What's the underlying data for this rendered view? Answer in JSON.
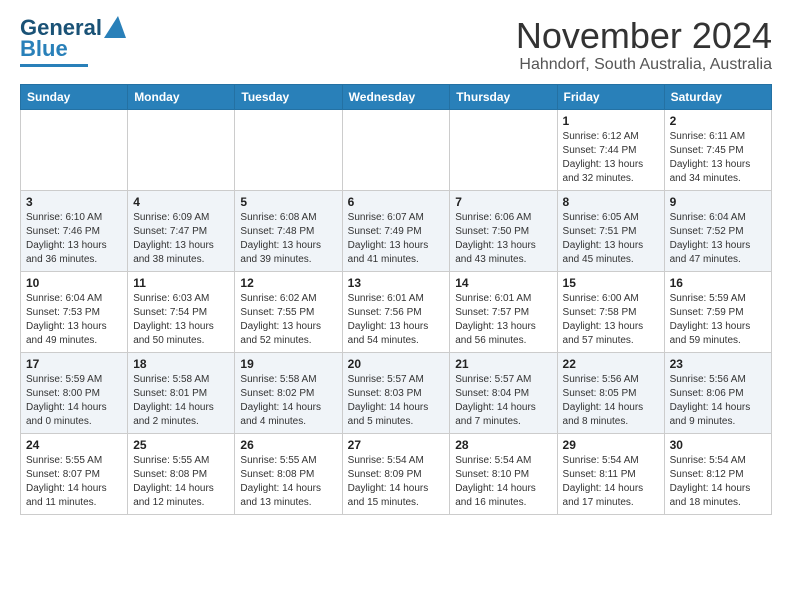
{
  "header": {
    "logo_line1": "General",
    "logo_line2": "Blue",
    "title": "November 2024",
    "subtitle": "Hahndorf, South Australia, Australia"
  },
  "weekdays": [
    "Sunday",
    "Monday",
    "Tuesday",
    "Wednesday",
    "Thursday",
    "Friday",
    "Saturday"
  ],
  "weeks": [
    [
      {
        "day": "",
        "info": ""
      },
      {
        "day": "",
        "info": ""
      },
      {
        "day": "",
        "info": ""
      },
      {
        "day": "",
        "info": ""
      },
      {
        "day": "",
        "info": ""
      },
      {
        "day": "1",
        "info": "Sunrise: 6:12 AM\nSunset: 7:44 PM\nDaylight: 13 hours\nand 32 minutes."
      },
      {
        "day": "2",
        "info": "Sunrise: 6:11 AM\nSunset: 7:45 PM\nDaylight: 13 hours\nand 34 minutes."
      }
    ],
    [
      {
        "day": "3",
        "info": "Sunrise: 6:10 AM\nSunset: 7:46 PM\nDaylight: 13 hours\nand 36 minutes."
      },
      {
        "day": "4",
        "info": "Sunrise: 6:09 AM\nSunset: 7:47 PM\nDaylight: 13 hours\nand 38 minutes."
      },
      {
        "day": "5",
        "info": "Sunrise: 6:08 AM\nSunset: 7:48 PM\nDaylight: 13 hours\nand 39 minutes."
      },
      {
        "day": "6",
        "info": "Sunrise: 6:07 AM\nSunset: 7:49 PM\nDaylight: 13 hours\nand 41 minutes."
      },
      {
        "day": "7",
        "info": "Sunrise: 6:06 AM\nSunset: 7:50 PM\nDaylight: 13 hours\nand 43 minutes."
      },
      {
        "day": "8",
        "info": "Sunrise: 6:05 AM\nSunset: 7:51 PM\nDaylight: 13 hours\nand 45 minutes."
      },
      {
        "day": "9",
        "info": "Sunrise: 6:04 AM\nSunset: 7:52 PM\nDaylight: 13 hours\nand 47 minutes."
      }
    ],
    [
      {
        "day": "10",
        "info": "Sunrise: 6:04 AM\nSunset: 7:53 PM\nDaylight: 13 hours\nand 49 minutes."
      },
      {
        "day": "11",
        "info": "Sunrise: 6:03 AM\nSunset: 7:54 PM\nDaylight: 13 hours\nand 50 minutes."
      },
      {
        "day": "12",
        "info": "Sunrise: 6:02 AM\nSunset: 7:55 PM\nDaylight: 13 hours\nand 52 minutes."
      },
      {
        "day": "13",
        "info": "Sunrise: 6:01 AM\nSunset: 7:56 PM\nDaylight: 13 hours\nand 54 minutes."
      },
      {
        "day": "14",
        "info": "Sunrise: 6:01 AM\nSunset: 7:57 PM\nDaylight: 13 hours\nand 56 minutes."
      },
      {
        "day": "15",
        "info": "Sunrise: 6:00 AM\nSunset: 7:58 PM\nDaylight: 13 hours\nand 57 minutes."
      },
      {
        "day": "16",
        "info": "Sunrise: 5:59 AM\nSunset: 7:59 PM\nDaylight: 13 hours\nand 59 minutes."
      }
    ],
    [
      {
        "day": "17",
        "info": "Sunrise: 5:59 AM\nSunset: 8:00 PM\nDaylight: 14 hours\nand 0 minutes."
      },
      {
        "day": "18",
        "info": "Sunrise: 5:58 AM\nSunset: 8:01 PM\nDaylight: 14 hours\nand 2 minutes."
      },
      {
        "day": "19",
        "info": "Sunrise: 5:58 AM\nSunset: 8:02 PM\nDaylight: 14 hours\nand 4 minutes."
      },
      {
        "day": "20",
        "info": "Sunrise: 5:57 AM\nSunset: 8:03 PM\nDaylight: 14 hours\nand 5 minutes."
      },
      {
        "day": "21",
        "info": "Sunrise: 5:57 AM\nSunset: 8:04 PM\nDaylight: 14 hours\nand 7 minutes."
      },
      {
        "day": "22",
        "info": "Sunrise: 5:56 AM\nSunset: 8:05 PM\nDaylight: 14 hours\nand 8 minutes."
      },
      {
        "day": "23",
        "info": "Sunrise: 5:56 AM\nSunset: 8:06 PM\nDaylight: 14 hours\nand 9 minutes."
      }
    ],
    [
      {
        "day": "24",
        "info": "Sunrise: 5:55 AM\nSunset: 8:07 PM\nDaylight: 14 hours\nand 11 minutes."
      },
      {
        "day": "25",
        "info": "Sunrise: 5:55 AM\nSunset: 8:08 PM\nDaylight: 14 hours\nand 12 minutes."
      },
      {
        "day": "26",
        "info": "Sunrise: 5:55 AM\nSunset: 8:08 PM\nDaylight: 14 hours\nand 13 minutes."
      },
      {
        "day": "27",
        "info": "Sunrise: 5:54 AM\nSunset: 8:09 PM\nDaylight: 14 hours\nand 15 minutes."
      },
      {
        "day": "28",
        "info": "Sunrise: 5:54 AM\nSunset: 8:10 PM\nDaylight: 14 hours\nand 16 minutes."
      },
      {
        "day": "29",
        "info": "Sunrise: 5:54 AM\nSunset: 8:11 PM\nDaylight: 14 hours\nand 17 minutes."
      },
      {
        "day": "30",
        "info": "Sunrise: 5:54 AM\nSunset: 8:12 PM\nDaylight: 14 hours\nand 18 minutes."
      }
    ]
  ]
}
